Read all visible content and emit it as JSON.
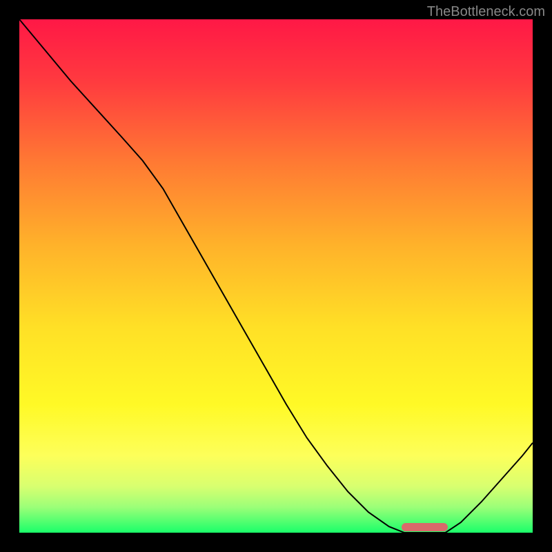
{
  "watermark": "TheBottleneck.com",
  "chart_data": {
    "type": "line",
    "title": "",
    "xlabel": "",
    "ylabel": "",
    "xlim": [
      0,
      100
    ],
    "ylim": [
      0,
      100
    ],
    "grid": false,
    "annotations": [
      {
        "kind": "marker",
        "shape": "pill",
        "color": "#d96a6a",
        "x_center": 79,
        "y": 0,
        "width_pct": 9
      }
    ],
    "curve": {
      "name": "bottleneck-curve",
      "color": "#000000",
      "points_xy_pct": [
        [
          0,
          100
        ],
        [
          5,
          94
        ],
        [
          10,
          88
        ],
        [
          15,
          82.5
        ],
        [
          20,
          77
        ],
        [
          24,
          72.5
        ],
        [
          28,
          67
        ],
        [
          32,
          60
        ],
        [
          36,
          53
        ],
        [
          40,
          46
        ],
        [
          44,
          39
        ],
        [
          48,
          32
        ],
        [
          52,
          25
        ],
        [
          56,
          18.5
        ],
        [
          60,
          13
        ],
        [
          64,
          8
        ],
        [
          68,
          4
        ],
        [
          72,
          1.2
        ],
        [
          75,
          0
        ],
        [
          78,
          0
        ],
        [
          81,
          0
        ],
        [
          83,
          0
        ],
        [
          86,
          2
        ],
        [
          90,
          6
        ],
        [
          94,
          10.5
        ],
        [
          98,
          15
        ],
        [
          100,
          17.5
        ]
      ]
    },
    "background_gradient": {
      "type": "vertical",
      "stops": [
        {
          "pct": 0,
          "color": "#ff1846"
        },
        {
          "pct": 12,
          "color": "#ff3a3f"
        },
        {
          "pct": 28,
          "color": "#ff7a33"
        },
        {
          "pct": 44,
          "color": "#ffb22a"
        },
        {
          "pct": 60,
          "color": "#ffe026"
        },
        {
          "pct": 75,
          "color": "#fff926"
        },
        {
          "pct": 85,
          "color": "#fdff5a"
        },
        {
          "pct": 91,
          "color": "#d8ff70"
        },
        {
          "pct": 95,
          "color": "#9cff78"
        },
        {
          "pct": 100,
          "color": "#1aff6a"
        }
      ]
    }
  }
}
